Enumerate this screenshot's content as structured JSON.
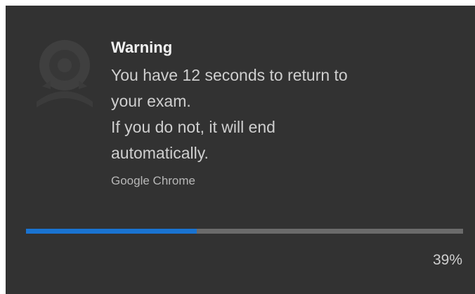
{
  "notification": {
    "title": "Warning",
    "message_lines": [
      "You have 12 seconds to return to",
      "your exam.",
      "If you do not, it will end",
      "automatically."
    ],
    "source": "Google Chrome",
    "progress_percent_label": "39%",
    "progress_fraction": 0.39,
    "icon": "exam-proctor-logo-icon"
  },
  "colors": {
    "background": "#323232",
    "progress_fill": "#1a73d1",
    "progress_track": "#6b6b6b",
    "title_text": "#f2f2f2",
    "body_text": "#cfcfcf"
  }
}
